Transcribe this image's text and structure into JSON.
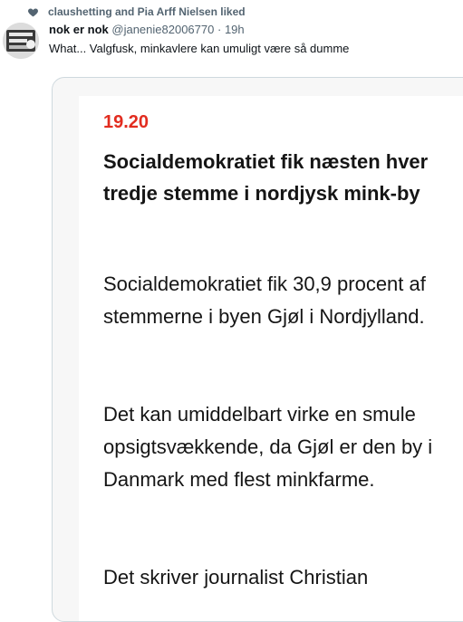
{
  "liked_by": "claushetting and Pia Arff Nielsen liked",
  "tweet": {
    "name": "nok er nok",
    "handle": "@janenie82006770",
    "dot": "·",
    "time": "19h",
    "text": "What... Valgfusk, minkavlere kan umuligt være så dumme"
  },
  "article": {
    "time": "19.20",
    "headline": "Socialdemokratiet fik næsten hver tredje stemme i nordjysk mink-by",
    "paragraphs": [
      "Socialdemokratiet fik 30,9 procent af stemmerne i byen Gjøl i Nordjylland.",
      "Det kan umiddelbart virke en smule opsigtsvækkende, da Gjøl er den by i Danmark med flest minkfarme.",
      "Det skriver journalist Christian"
    ]
  },
  "icons": {
    "liked": "heart-icon",
    "avatar": "avatar-image"
  },
  "colors": {
    "secondary_text": "#536471",
    "accent_time": "#e22c1f",
    "border": "#cfd9de"
  }
}
